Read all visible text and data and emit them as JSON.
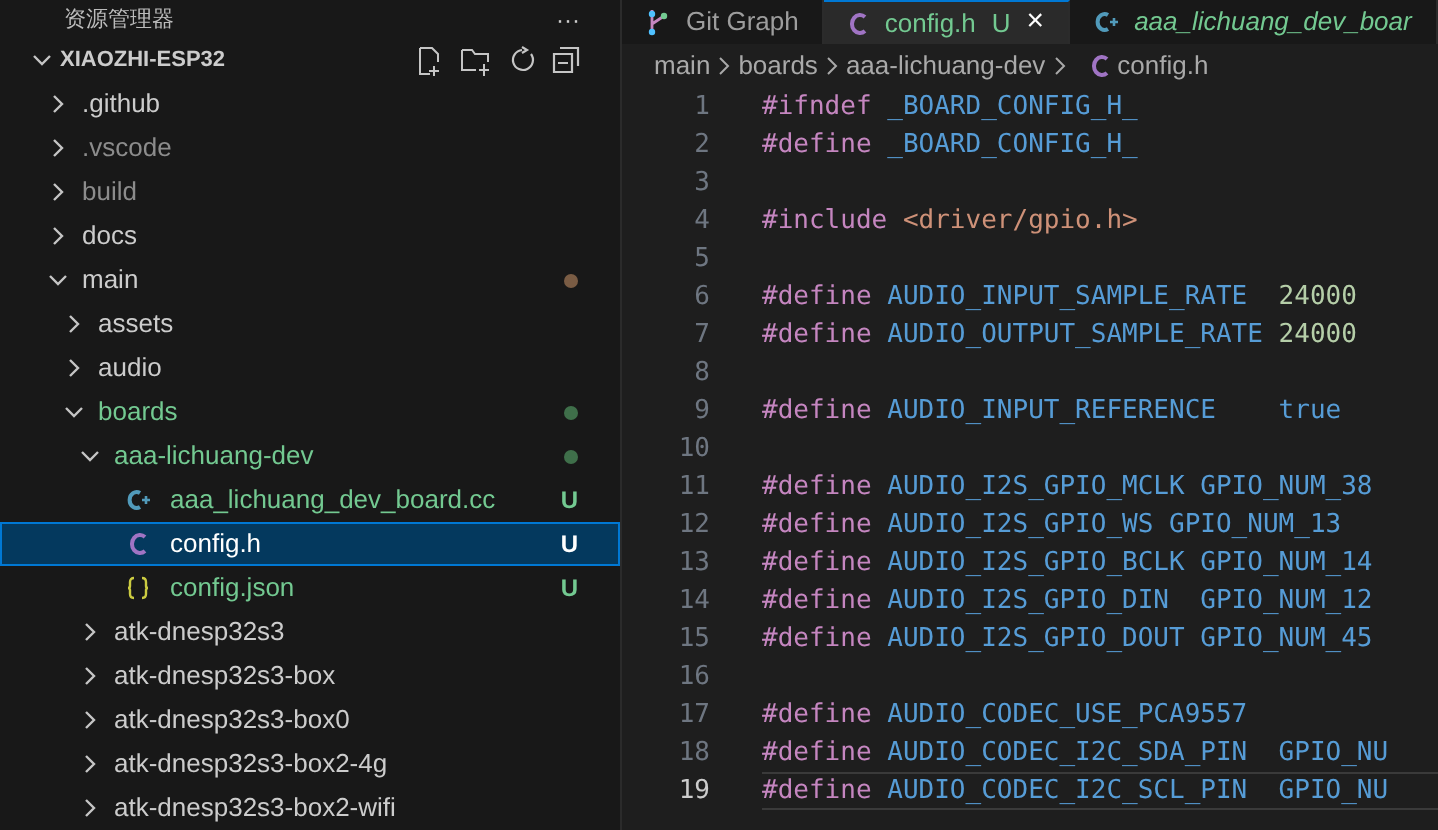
{
  "explorer": {
    "title": "资源管理器",
    "more": "···"
  },
  "project": {
    "name": "XIAOZHI-ESP32",
    "expanded": true
  },
  "tree": [
    {
      "label": ".github",
      "kind": "folder",
      "expanded": false,
      "color": "#cccccc",
      "selected": false
    },
    {
      "label": ".vscode",
      "kind": "folder",
      "expanded": false,
      "color": "#8c8c8c",
      "selected": false
    },
    {
      "label": "build",
      "kind": "folder",
      "expanded": false,
      "color": "#8c8c8c",
      "selected": false
    },
    {
      "label": "docs",
      "kind": "folder",
      "expanded": false,
      "color": "#cccccc",
      "selected": false
    },
    {
      "label": "main",
      "kind": "folder",
      "expanded": true,
      "color": "#cccccc",
      "dot": {
        "color": "#7a5c44"
      },
      "selected": false,
      "children": [
        {
          "label": "assets",
          "kind": "folder",
          "expanded": false,
          "color": "#cccccc",
          "selected": false
        },
        {
          "label": "audio",
          "kind": "folder",
          "expanded": false,
          "color": "#cccccc",
          "selected": false
        },
        {
          "label": "boards",
          "kind": "folder",
          "expanded": true,
          "color": "#73c991",
          "dot": {
            "color": "#3f6f4a"
          },
          "selected": false,
          "children": [
            {
              "label": "aaa-lichuang-dev",
              "kind": "folder",
              "expanded": true,
              "color": "#73c991",
              "dot": {
                "color": "#3f6f4a"
              },
              "selected": false,
              "children": [
                {
                  "label": "aaa_lichuang_dev_board.cc",
                  "kind": "cpp",
                  "color": "#73c991",
                  "badge": "U",
                  "selected": false
                },
                {
                  "label": "config.h",
                  "kind": "c",
                  "badge": "U",
                  "selected": true
                },
                {
                  "label": "config.json",
                  "kind": "json",
                  "color": "#73c991",
                  "badge": "U",
                  "selected": false
                }
              ]
            },
            {
              "label": "atk-dnesp32s3",
              "kind": "folder",
              "expanded": false,
              "color": "#cccccc",
              "selected": false
            },
            {
              "label": "atk-dnesp32s3-box",
              "kind": "folder",
              "expanded": false,
              "color": "#cccccc",
              "selected": false
            },
            {
              "label": "atk-dnesp32s3-box0",
              "kind": "folder",
              "expanded": false,
              "color": "#cccccc",
              "selected": false
            },
            {
              "label": "atk-dnesp32s3-box2-4g",
              "kind": "folder",
              "expanded": false,
              "color": "#cccccc",
              "selected": false
            },
            {
              "label": "atk-dnesp32s3-box2-wifi",
              "kind": "folder",
              "expanded": false,
              "color": "#cccccc",
              "selected": false
            }
          ]
        }
      ]
    }
  ],
  "tabs": [
    {
      "label": "Git Graph",
      "kind": "graph",
      "selected": false
    },
    {
      "label": "config.h",
      "kind": "c",
      "badge": "U",
      "close": "×",
      "selected": true
    },
    {
      "label": "aaa_lichuang_dev_boar",
      "kind": "cpp",
      "selected": false
    }
  ],
  "breadcrumb": [
    {
      "label": "main",
      "kind": "text"
    },
    {
      "label": "boards",
      "kind": "text"
    },
    {
      "label": "aaa-lichuang-dev",
      "kind": "text"
    },
    {
      "label": "config.h",
      "kind": "c"
    }
  ],
  "lines": [
    {
      "number": "1",
      "current": false,
      "tokens": [
        {
          "text": "#ifndef",
          "kind": "directive"
        },
        {
          "text": " _BOARD_CONFIG_H_",
          "kind": "macro"
        }
      ]
    },
    {
      "number": "2",
      "current": false,
      "tokens": [
        {
          "text": "#define",
          "kind": "directive"
        },
        {
          "text": " _BOARD_CONFIG_H_",
          "kind": "macro"
        }
      ]
    },
    {
      "number": "3",
      "current": false
    },
    {
      "number": "4",
      "current": false,
      "tokens": [
        {
          "text": "#include",
          "kind": "directive"
        },
        {
          "text": " <driver/gpio.h>",
          "kind": "string"
        }
      ]
    },
    {
      "number": "5",
      "current": false
    },
    {
      "number": "6",
      "current": false,
      "tokens": [
        {
          "text": "#define",
          "kind": "directive"
        },
        {
          "text": " AUDIO_INPUT_SAMPLE_RATE",
          "kind": "macro"
        },
        {
          "text": "  24000",
          "kind": "number"
        }
      ]
    },
    {
      "number": "7",
      "current": false,
      "tokens": [
        {
          "text": "#define",
          "kind": "directive"
        },
        {
          "text": " AUDIO_OUTPUT_SAMPLE_RATE",
          "kind": "macro"
        },
        {
          "text": " 24000",
          "kind": "number"
        }
      ]
    },
    {
      "number": "8",
      "current": false
    },
    {
      "number": "9",
      "current": false,
      "tokens": [
        {
          "text": "#define",
          "kind": "directive"
        },
        {
          "text": " AUDIO_INPUT_REFERENCE    true",
          "kind": "macro"
        }
      ]
    },
    {
      "number": "10",
      "current": false
    },
    {
      "number": "11",
      "current": false,
      "tokens": [
        {
          "text": "#define",
          "kind": "directive"
        },
        {
          "text": " AUDIO_I2S_GPIO_MCLK GPIO_NUM_38",
          "kind": "macro"
        }
      ]
    },
    {
      "number": "12",
      "current": false,
      "tokens": [
        {
          "text": "#define",
          "kind": "directive"
        },
        {
          "text": " AUDIO_I2S_GPIO_WS GPIO_NUM_13",
          "kind": "macro"
        }
      ]
    },
    {
      "number": "13",
      "current": false,
      "tokens": [
        {
          "text": "#define",
          "kind": "directive"
        },
        {
          "text": " AUDIO_I2S_GPIO_BCLK GPIO_NUM_14",
          "kind": "macro"
        }
      ]
    },
    {
      "number": "14",
      "current": false,
      "tokens": [
        {
          "text": "#define",
          "kind": "directive"
        },
        {
          "text": " AUDIO_I2S_GPIO_DIN  GPIO_NUM_12",
          "kind": "macro"
        }
      ]
    },
    {
      "number": "15",
      "current": false,
      "tokens": [
        {
          "text": "#define",
          "kind": "directive"
        },
        {
          "text": " AUDIO_I2S_GPIO_DOUT GPIO_NUM_45",
          "kind": "macro"
        }
      ]
    },
    {
      "number": "16",
      "current": false
    },
    {
      "number": "17",
      "current": false,
      "tokens": [
        {
          "text": "#define",
          "kind": "directive"
        },
        {
          "text": " AUDIO_CODEC_USE_PCA9557",
          "kind": "macro"
        }
      ]
    },
    {
      "number": "18",
      "current": false,
      "tokens": [
        {
          "text": "#define",
          "kind": "directive"
        },
        {
          "text": " AUDIO_CODEC_I2C_SDA_PIN  GPIO_NU",
          "kind": "macro"
        }
      ]
    },
    {
      "number": "19",
      "current": true,
      "tokens": [
        {
          "text": "#define",
          "kind": "directive"
        },
        {
          "text": " AUDIO_CODEC_I2C_SCL_PIN  GPIO_NU",
          "kind": "macro"
        }
      ]
    }
  ]
}
